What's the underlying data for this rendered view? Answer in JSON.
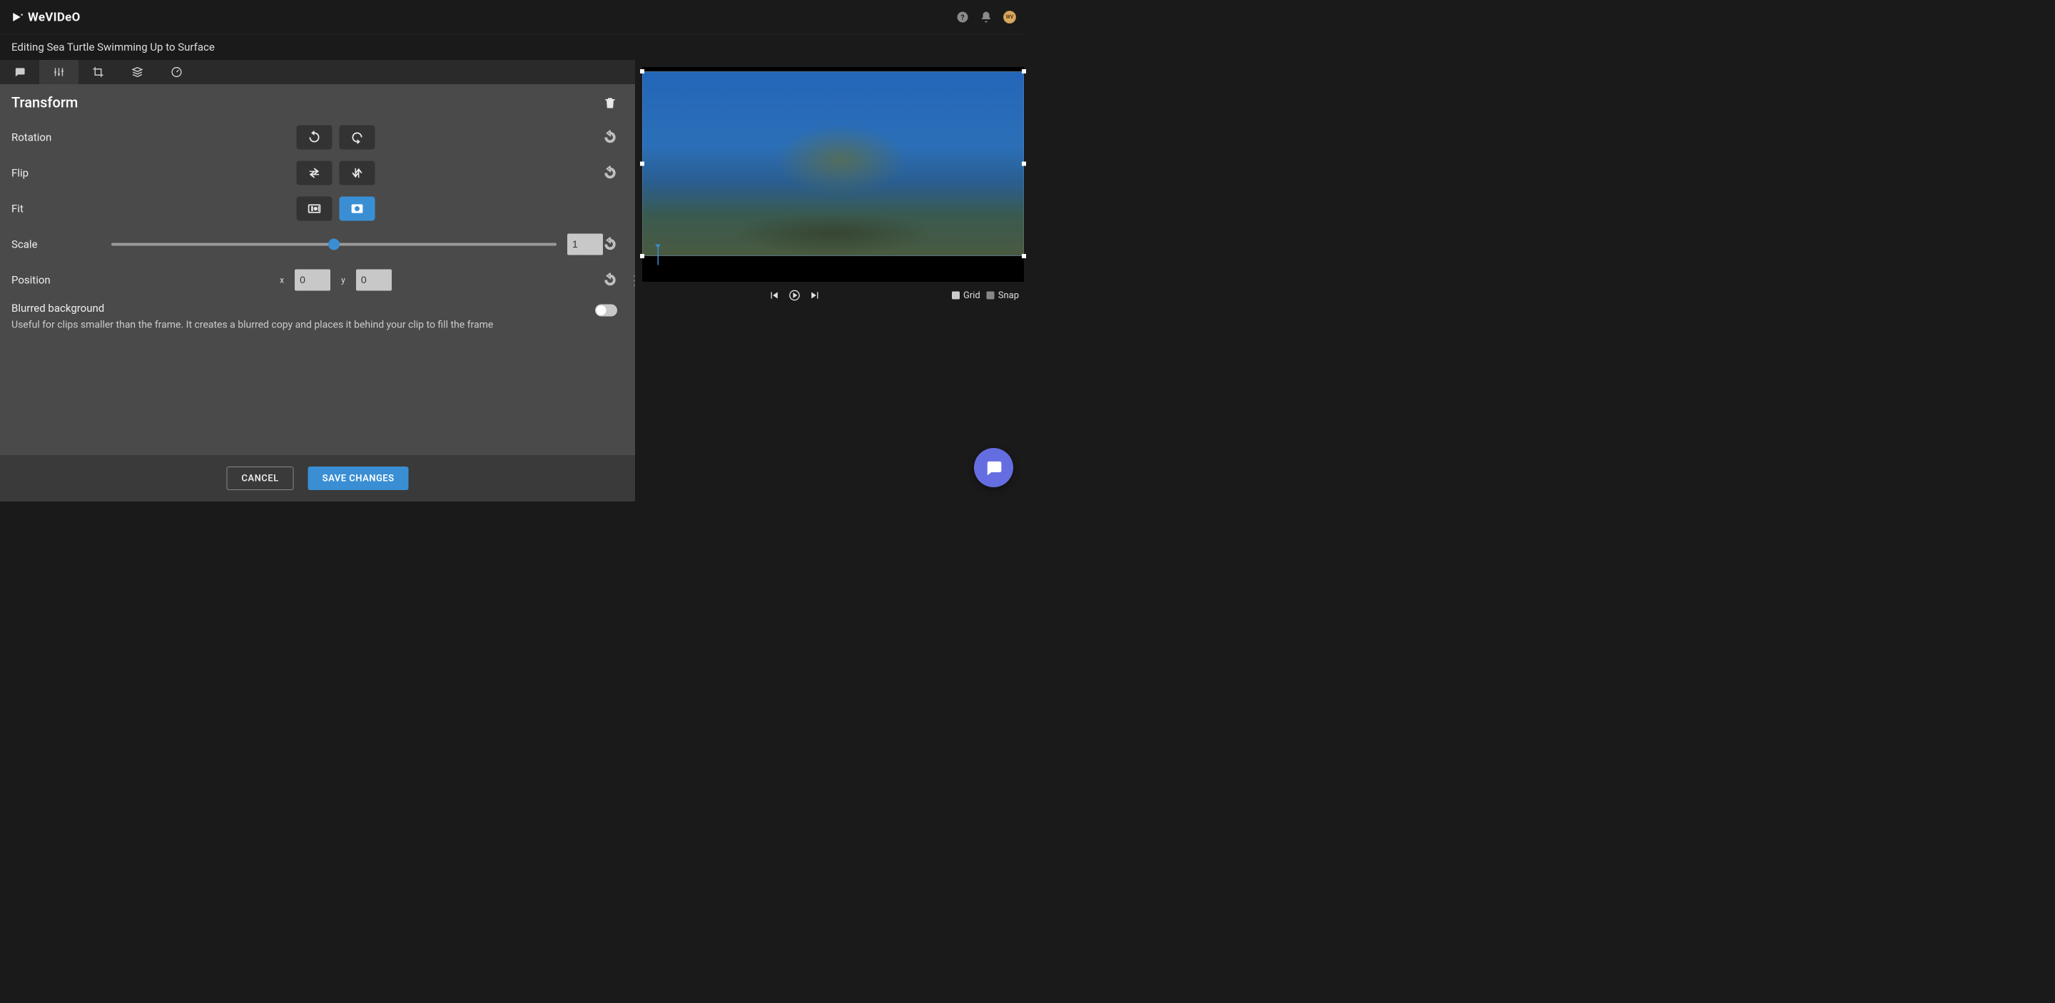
{
  "header": {
    "logo_text": "WeVIDeO",
    "avatar_initials": "WV"
  },
  "sub": {
    "title": "Editing Sea Turtle Swimming Up to Surface"
  },
  "panel": {
    "title": "Transform",
    "rows": {
      "rotation": "Rotation",
      "flip": "Flip",
      "fit": "Fit",
      "scale": "Scale",
      "position": "Position"
    },
    "scale_value": "1",
    "position": {
      "x_label": "x",
      "x": "0",
      "y_label": "y",
      "y": "0"
    },
    "blur": {
      "title": "Blurred background",
      "desc": "Useful for clips smaller than the frame. It creates a blurred copy and places it behind your clip to fill the frame"
    }
  },
  "footer": {
    "cancel": "CANCEL",
    "save": "SAVE CHANGES"
  },
  "preview": {
    "grid": "Grid",
    "snap": "Snap"
  }
}
